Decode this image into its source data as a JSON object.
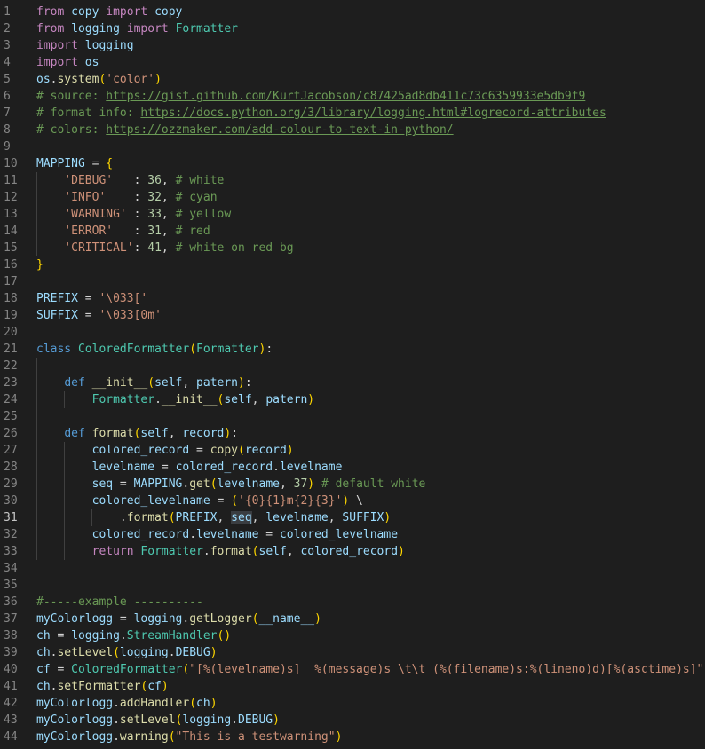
{
  "editor": {
    "language": "python",
    "active_line": 31,
    "colors": {
      "background": "#1e1e1e",
      "line_number": "#858585",
      "keyword": "#c586c0",
      "declaration": "#569cd6",
      "function": "#dcdcaa",
      "class": "#4ec9b0",
      "variable": "#9cdcfe",
      "string": "#ce9178",
      "number": "#b5cea8",
      "comment": "#6a9955",
      "default": "#d4d4d4",
      "bracket1": "#ffd700",
      "bracket2": "#da70d6",
      "bracket3": "#179fff"
    },
    "lines": [
      {
        "n": "1",
        "indent": 0,
        "tokens": [
          [
            "k",
            "from"
          ],
          [
            "d",
            " "
          ],
          [
            "v",
            "copy"
          ],
          [
            "d",
            " "
          ],
          [
            "k",
            "import"
          ],
          [
            "d",
            " "
          ],
          [
            "v",
            "copy"
          ]
        ]
      },
      {
        "n": "2",
        "indent": 0,
        "tokens": [
          [
            "k",
            "from"
          ],
          [
            "d",
            " "
          ],
          [
            "v",
            "logging"
          ],
          [
            "d",
            " "
          ],
          [
            "k",
            "import"
          ],
          [
            "d",
            " "
          ],
          [
            "c",
            "Formatter"
          ]
        ]
      },
      {
        "n": "3",
        "indent": 0,
        "tokens": [
          [
            "k",
            "import"
          ],
          [
            "d",
            " "
          ],
          [
            "v",
            "logging"
          ]
        ]
      },
      {
        "n": "4",
        "indent": 0,
        "tokens": [
          [
            "k",
            "import"
          ],
          [
            "d",
            " "
          ],
          [
            "v",
            "os"
          ]
        ]
      },
      {
        "n": "5",
        "indent": 0,
        "tokens": [
          [
            "v",
            "os"
          ],
          [
            "d",
            "."
          ],
          [
            "f",
            "system"
          ],
          [
            "b1",
            "("
          ],
          [
            "s",
            "'color'"
          ],
          [
            "b1",
            ")"
          ]
        ]
      },
      {
        "n": "6",
        "indent": 0,
        "tokens": [
          [
            "cm",
            "# source: "
          ],
          [
            "u",
            "https://gist.github.com/KurtJacobson/c87425ad8db411c73c6359933e5db9f9"
          ]
        ]
      },
      {
        "n": "7",
        "indent": 0,
        "tokens": [
          [
            "cm",
            "# format info: "
          ],
          [
            "u",
            "https://docs.python.org/3/library/logging.html#logrecord-attributes"
          ]
        ]
      },
      {
        "n": "8",
        "indent": 0,
        "tokens": [
          [
            "cm",
            "# colors: "
          ],
          [
            "u",
            "https://ozzmaker.com/add-colour-to-text-in-python/"
          ]
        ]
      },
      {
        "n": "9",
        "indent": 0,
        "tokens": []
      },
      {
        "n": "10",
        "indent": 0,
        "tokens": [
          [
            "v",
            "MAPPING"
          ],
          [
            "d",
            " = "
          ],
          [
            "b1",
            "{"
          ]
        ]
      },
      {
        "n": "11",
        "indent": 1,
        "tokens": [
          [
            "d",
            "    "
          ],
          [
            "s",
            "'DEBUG'"
          ],
          [
            "d",
            "   : "
          ],
          [
            "nm",
            "36"
          ],
          [
            "d",
            ", "
          ],
          [
            "cm",
            "# white"
          ]
        ]
      },
      {
        "n": "12",
        "indent": 1,
        "tokens": [
          [
            "d",
            "    "
          ],
          [
            "s",
            "'INFO'"
          ],
          [
            "d",
            "    : "
          ],
          [
            "nm",
            "32"
          ],
          [
            "d",
            ", "
          ],
          [
            "cm",
            "# cyan"
          ]
        ]
      },
      {
        "n": "13",
        "indent": 1,
        "tokens": [
          [
            "d",
            "    "
          ],
          [
            "s",
            "'WARNING'"
          ],
          [
            "d",
            " : "
          ],
          [
            "nm",
            "33"
          ],
          [
            "d",
            ", "
          ],
          [
            "cm",
            "# yellow"
          ]
        ]
      },
      {
        "n": "14",
        "indent": 1,
        "tokens": [
          [
            "d",
            "    "
          ],
          [
            "s",
            "'ERROR'"
          ],
          [
            "d",
            "   : "
          ],
          [
            "nm",
            "31"
          ],
          [
            "d",
            ", "
          ],
          [
            "cm",
            "# red"
          ]
        ]
      },
      {
        "n": "15",
        "indent": 1,
        "tokens": [
          [
            "d",
            "    "
          ],
          [
            "s",
            "'CRITICAL'"
          ],
          [
            "d",
            ": "
          ],
          [
            "nm",
            "41"
          ],
          [
            "d",
            ", "
          ],
          [
            "cm",
            "# white on red bg"
          ]
        ]
      },
      {
        "n": "16",
        "indent": 0,
        "tokens": [
          [
            "b1",
            "}"
          ]
        ]
      },
      {
        "n": "17",
        "indent": 0,
        "tokens": []
      },
      {
        "n": "18",
        "indent": 0,
        "tokens": [
          [
            "v",
            "PREFIX"
          ],
          [
            "d",
            " = "
          ],
          [
            "s",
            "'\\033['"
          ]
        ]
      },
      {
        "n": "19",
        "indent": 0,
        "tokens": [
          [
            "v",
            "SUFFIX"
          ],
          [
            "d",
            " = "
          ],
          [
            "s",
            "'\\033[0m'"
          ]
        ]
      },
      {
        "n": "20",
        "indent": 0,
        "tokens": []
      },
      {
        "n": "21",
        "indent": 0,
        "tokens": [
          [
            "dc",
            "class"
          ],
          [
            "d",
            " "
          ],
          [
            "c",
            "ColoredFormatter"
          ],
          [
            "b1",
            "("
          ],
          [
            "c",
            "Formatter"
          ],
          [
            "b1",
            ")"
          ],
          [
            "d",
            ":"
          ]
        ]
      },
      {
        "n": "22",
        "indent": 1,
        "tokens": []
      },
      {
        "n": "23",
        "indent": 1,
        "tokens": [
          [
            "d",
            "    "
          ],
          [
            "dc",
            "def"
          ],
          [
            "d",
            " "
          ],
          [
            "f",
            "__init__"
          ],
          [
            "b1",
            "("
          ],
          [
            "v",
            "self"
          ],
          [
            "d",
            ", "
          ],
          [
            "v",
            "patern"
          ],
          [
            "b1",
            ")"
          ],
          [
            "d",
            ":"
          ]
        ]
      },
      {
        "n": "24",
        "indent": 2,
        "tokens": [
          [
            "d",
            "        "
          ],
          [
            "c",
            "Formatter"
          ],
          [
            "d",
            "."
          ],
          [
            "f",
            "__init__"
          ],
          [
            "b1",
            "("
          ],
          [
            "v",
            "self"
          ],
          [
            "d",
            ", "
          ],
          [
            "v",
            "patern"
          ],
          [
            "b1",
            ")"
          ]
        ]
      },
      {
        "n": "25",
        "indent": 1,
        "tokens": []
      },
      {
        "n": "26",
        "indent": 1,
        "tokens": [
          [
            "d",
            "    "
          ],
          [
            "dc",
            "def"
          ],
          [
            "d",
            " "
          ],
          [
            "f",
            "format"
          ],
          [
            "b1",
            "("
          ],
          [
            "v",
            "self"
          ],
          [
            "d",
            ", "
          ],
          [
            "v",
            "record"
          ],
          [
            "b1",
            ")"
          ],
          [
            "d",
            ":"
          ]
        ]
      },
      {
        "n": "27",
        "indent": 2,
        "tokens": [
          [
            "d",
            "        "
          ],
          [
            "v",
            "colored_record"
          ],
          [
            "d",
            " = "
          ],
          [
            "f",
            "copy"
          ],
          [
            "b1",
            "("
          ],
          [
            "v",
            "record"
          ],
          [
            "b1",
            ")"
          ]
        ]
      },
      {
        "n": "28",
        "indent": 2,
        "tokens": [
          [
            "d",
            "        "
          ],
          [
            "v",
            "levelname"
          ],
          [
            "d",
            " = "
          ],
          [
            "v",
            "colored_record"
          ],
          [
            "d",
            "."
          ],
          [
            "v",
            "levelname"
          ]
        ]
      },
      {
        "n": "29",
        "indent": 2,
        "tokens": [
          [
            "d",
            "        "
          ],
          [
            "v",
            "seq"
          ],
          [
            "d",
            " = "
          ],
          [
            "v",
            "MAPPING"
          ],
          [
            "d",
            "."
          ],
          [
            "f",
            "get"
          ],
          [
            "b1",
            "("
          ],
          [
            "v",
            "levelname"
          ],
          [
            "d",
            ", "
          ],
          [
            "nm",
            "37"
          ],
          [
            "b1",
            ")"
          ],
          [
            "d",
            " "
          ],
          [
            "cm",
            "# default white"
          ]
        ]
      },
      {
        "n": "30",
        "indent": 2,
        "tokens": [
          [
            "d",
            "        "
          ],
          [
            "v",
            "colored_levelname"
          ],
          [
            "d",
            " = "
          ],
          [
            "b1",
            "("
          ],
          [
            "s",
            "'{0}{1}m{2}{3}'"
          ],
          [
            "b1",
            ")"
          ],
          [
            "d",
            " \\"
          ]
        ]
      },
      {
        "n": "31",
        "indent": 3,
        "tokens": [
          [
            "d",
            "            ."
          ],
          [
            "f",
            "format"
          ],
          [
            "b1",
            "("
          ],
          [
            "v",
            "PREFIX"
          ],
          [
            "d",
            ", "
          ],
          [
            "vh",
            "seq"
          ],
          [
            "d",
            ", "
          ],
          [
            "v",
            "levelname"
          ],
          [
            "d",
            ", "
          ],
          [
            "v",
            "SUFFIX"
          ],
          [
            "b1",
            ")"
          ]
        ]
      },
      {
        "n": "32",
        "indent": 2,
        "tokens": [
          [
            "d",
            "        "
          ],
          [
            "v",
            "colored_record"
          ],
          [
            "d",
            "."
          ],
          [
            "v",
            "levelname"
          ],
          [
            "d",
            " = "
          ],
          [
            "v",
            "colored_levelname"
          ]
        ]
      },
      {
        "n": "33",
        "indent": 2,
        "tokens": [
          [
            "d",
            "        "
          ],
          [
            "k",
            "return"
          ],
          [
            "d",
            " "
          ],
          [
            "c",
            "Formatter"
          ],
          [
            "d",
            "."
          ],
          [
            "f",
            "format"
          ],
          [
            "b1",
            "("
          ],
          [
            "v",
            "self"
          ],
          [
            "d",
            ", "
          ],
          [
            "v",
            "colored_record"
          ],
          [
            "b1",
            ")"
          ]
        ]
      },
      {
        "n": "34",
        "indent": 0,
        "tokens": []
      },
      {
        "n": "35",
        "indent": 0,
        "tokens": []
      },
      {
        "n": "36",
        "indent": 0,
        "tokens": [
          [
            "cm",
            "#-----example ----------"
          ]
        ]
      },
      {
        "n": "37",
        "indent": 0,
        "tokens": [
          [
            "v",
            "myColorlogg"
          ],
          [
            "d",
            " = "
          ],
          [
            "v",
            "logging"
          ],
          [
            "d",
            "."
          ],
          [
            "f",
            "getLogger"
          ],
          [
            "b1",
            "("
          ],
          [
            "v",
            "__name__"
          ],
          [
            "b1",
            ")"
          ]
        ]
      },
      {
        "n": "38",
        "indent": 0,
        "tokens": [
          [
            "v",
            "ch"
          ],
          [
            "d",
            " = "
          ],
          [
            "v",
            "logging"
          ],
          [
            "d",
            "."
          ],
          [
            "c",
            "StreamHandler"
          ],
          [
            "b1",
            "()"
          ]
        ]
      },
      {
        "n": "39",
        "indent": 0,
        "tokens": [
          [
            "v",
            "ch"
          ],
          [
            "d",
            "."
          ],
          [
            "f",
            "setLevel"
          ],
          [
            "b1",
            "("
          ],
          [
            "v",
            "logging"
          ],
          [
            "d",
            "."
          ],
          [
            "v",
            "DEBUG"
          ],
          [
            "b1",
            ")"
          ]
        ]
      },
      {
        "n": "40",
        "indent": 0,
        "tokens": [
          [
            "v",
            "cf"
          ],
          [
            "d",
            " = "
          ],
          [
            "c",
            "ColoredFormatter"
          ],
          [
            "b1",
            "("
          ],
          [
            "s",
            "\"[%(levelname)s]  %(message)s \\t\\t (%(filename)s:%(lineno)d)[%(asctime)s]\""
          ],
          [
            "b1",
            ")"
          ]
        ]
      },
      {
        "n": "41",
        "indent": 0,
        "tokens": [
          [
            "v",
            "ch"
          ],
          [
            "d",
            "."
          ],
          [
            "f",
            "setFormatter"
          ],
          [
            "b1",
            "("
          ],
          [
            "v",
            "cf"
          ],
          [
            "b1",
            ")"
          ]
        ]
      },
      {
        "n": "42",
        "indent": 0,
        "tokens": [
          [
            "v",
            "myColorlogg"
          ],
          [
            "d",
            "."
          ],
          [
            "f",
            "addHandler"
          ],
          [
            "b1",
            "("
          ],
          [
            "v",
            "ch"
          ],
          [
            "b1",
            ")"
          ]
        ]
      },
      {
        "n": "43",
        "indent": 0,
        "tokens": [
          [
            "v",
            "myColorlogg"
          ],
          [
            "d",
            "."
          ],
          [
            "f",
            "setLevel"
          ],
          [
            "b1",
            "("
          ],
          [
            "v",
            "logging"
          ],
          [
            "d",
            "."
          ],
          [
            "v",
            "DEBUG"
          ],
          [
            "b1",
            ")"
          ]
        ]
      },
      {
        "n": "44",
        "indent": 0,
        "tokens": [
          [
            "v",
            "myColorlogg"
          ],
          [
            "d",
            "."
          ],
          [
            "f",
            "warning"
          ],
          [
            "b1",
            "("
          ],
          [
            "s",
            "\"This is a testwarning\""
          ],
          [
            "b1",
            ")"
          ]
        ]
      }
    ]
  }
}
